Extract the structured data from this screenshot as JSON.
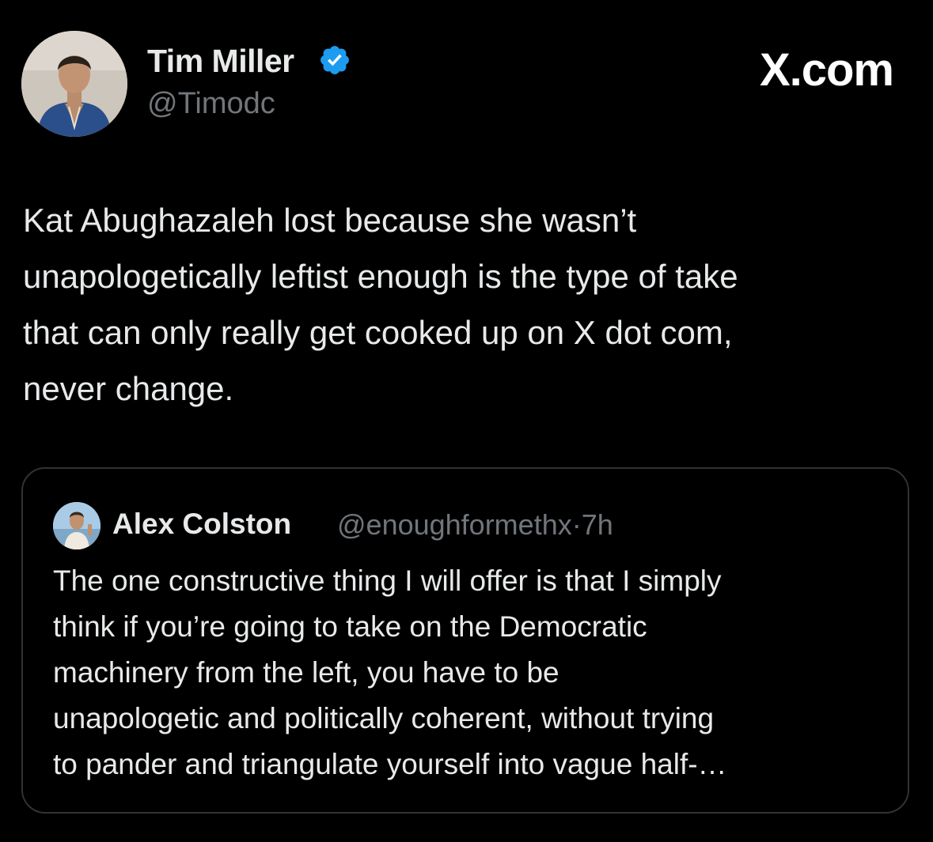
{
  "author": {
    "name": "Tim Miller",
    "handle": "@Timodc",
    "verified": true,
    "verified_color": "#1d9bf0"
  },
  "brand": {
    "text": "X.com"
  },
  "tweet": {
    "text": "Kat Abughazaleh lost because she wasn’t\nunapologetically leftist enough is the type of take\nthat can only really get cooked up on X dot com,\nnever change."
  },
  "quote": {
    "author_name": "Alex Colston",
    "author_handle": "@enoughformethx",
    "separator": "·",
    "time": "7h",
    "text": "The one constructive thing I will offer is that I simply\nthink if you’re going to take on the Democratic\nmachinery from the left, you have to be\nunapologetic and politically coherent, without trying\nto pander and triangulate yourself into vague half-…"
  },
  "colors": {
    "background": "#000000",
    "primary_text": "#e7e9ea",
    "secondary_text": "#71767b",
    "border": "#2f3336"
  }
}
